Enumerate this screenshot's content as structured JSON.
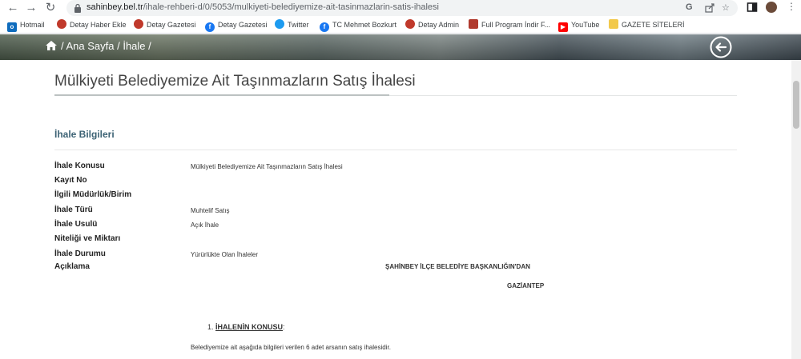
{
  "browser": {
    "url_host": "sahinbey.bel.tr",
    "url_path": "/ihale-rehberi-d/0/5053/mulkiyeti-belediyemize-ait-tasinmazlarin-satis-ihalesi"
  },
  "bookmarks": [
    {
      "label": "Hotmail",
      "icon": "outlook-icon",
      "color": "#0f6cbd"
    },
    {
      "label": "Detay Haber Ekle",
      "icon": "site-icon",
      "color": "#c0392b"
    },
    {
      "label": "Detay Gazetesi",
      "icon": "site-icon",
      "color": "#c0392b"
    },
    {
      "label": "Detay Gazetesi",
      "icon": "facebook-icon",
      "color": "#1877f2"
    },
    {
      "label": "Twitter",
      "icon": "twitter-icon",
      "color": "#1d9bf0"
    },
    {
      "label": "TC Mehmet Bozkurt",
      "icon": "facebook-icon",
      "color": "#1877f2"
    },
    {
      "label": "Detay Admin",
      "icon": "site-icon",
      "color": "#c0392b"
    },
    {
      "label": "Full Program İndir F...",
      "icon": "site-icon",
      "color": "#b03a2e"
    },
    {
      "label": "YouTube",
      "icon": "youtube-icon",
      "color": "#ff0000"
    },
    {
      "label": "GAZETE SİTELERİ",
      "icon": "folder-icon",
      "color": "#f2c94c"
    }
  ],
  "breadcrumb": {
    "text": "/ Ana Sayfa / İhale /"
  },
  "page": {
    "title": "Mülkiyeti Belediyemize Ait Taşınmazların Satış İhalesi",
    "section_title": "İhale Bilgileri"
  },
  "fields": [
    {
      "label": "İhale Konusu",
      "value": "Mülkiyeti Belediyemize Ait Taşınmazların Satış İhalesi"
    },
    {
      "label": "Kayıt No",
      "value": ""
    },
    {
      "label": "İlgili Müdürlük/Birim",
      "value": ""
    },
    {
      "label": "İhale Türü",
      "value": "Muhtelif Satış"
    },
    {
      "label": "İhale Usulü",
      "value": "Açık İhale"
    },
    {
      "label": "Niteliği ve Miktarı",
      "value": ""
    },
    {
      "label": "İhale Durumu",
      "value": "Yürürlükte Olan İhaleler"
    },
    {
      "label": "Açıklama",
      "value": ""
    }
  ],
  "description": {
    "heading": "ŞAHİNBEY İLÇE BELEDİYE BAŞKANLIĞIN'DAN",
    "city": "GAZİANTEP",
    "item_number": "1.",
    "item_title": "İHALENİN KONUSU",
    "item_suffix": ":",
    "text": "Belediyemize ait aşağıda bilgileri verilen 6 adet arsanın satış ihalesidir."
  }
}
